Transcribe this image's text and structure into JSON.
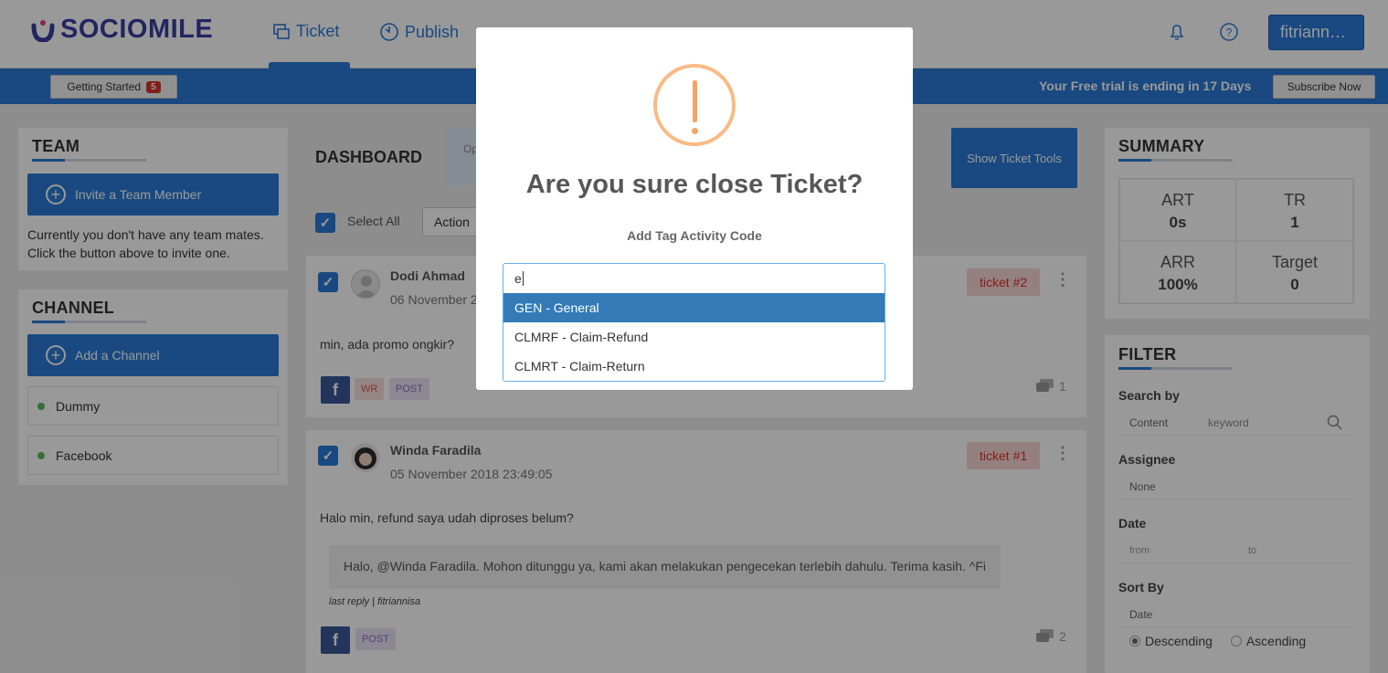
{
  "app": {
    "brand": "SOCIOMILE"
  },
  "nav": {
    "items": [
      {
        "label": "Ticket"
      },
      {
        "label": "Publish"
      }
    ],
    "user_label": "fitriann…"
  },
  "banner": {
    "getting_started_label": "Getting Started",
    "getting_started_count": "5",
    "trial_text": "Your Free trial is ending in 17 Days",
    "subscribe_label": "Subscribe Now"
  },
  "team": {
    "title": "TEAM",
    "invite_label": "Invite a Team Member",
    "empty_text": "Currently you don't have any team mates. Click the button above to invite one."
  },
  "channel": {
    "title": "CHANNEL",
    "add_label": "Add a Channel",
    "items": [
      {
        "label": "Dummy"
      },
      {
        "label": "Facebook"
      }
    ]
  },
  "dashboard": {
    "title": "DASHBOARD",
    "tab_label": "Op",
    "show_tools_label": "Show Ticket Tools",
    "select_all_label": "Select All",
    "action_label": "Action"
  },
  "tickets": [
    {
      "name": "Dodi Ahmad",
      "date": "06 November 2",
      "body": "min, ada promo ongkir?",
      "badge": "ticket #2",
      "tags": [
        "WR",
        "POST"
      ],
      "comments": "1"
    },
    {
      "name": "Winda Faradila",
      "date": "05 November 2018 23:49:05",
      "body": "Halo min, refund saya udah diproses belum?",
      "badge": "ticket #1",
      "tags": [
        "POST"
      ],
      "comments": "2",
      "reply": "Halo, @Winda Faradila. Mohon ditunggu ya, kami akan melakukan pengecekan terlebih dahulu. Terima kasih. ^Fi",
      "reply_meta": "last reply | fitriannisa"
    }
  ],
  "summary": {
    "title": "SUMMARY",
    "cells": [
      {
        "label": "ART",
        "value": "0s"
      },
      {
        "label": "TR",
        "value": "1"
      },
      {
        "label": "ARR",
        "value": "100%"
      },
      {
        "label": "Target",
        "value": "0"
      }
    ]
  },
  "filter": {
    "title": "FILTER",
    "search_by_label": "Search by",
    "search_field": "Content",
    "search_placeholder": "keyword",
    "assignee_label": "Assignee",
    "assignee_value": "None",
    "date_label": "Date",
    "date_from_placeholder": "from",
    "date_to_placeholder": "to",
    "sort_label": "Sort By",
    "sort_value": "Date",
    "sort_desc": "Descending",
    "sort_asc": "Ascending"
  },
  "modal": {
    "title": "Are you sure close Ticket?",
    "subtitle": "Add Tag Activity Code",
    "input_value": "e",
    "options": [
      {
        "label": "GEN - General"
      },
      {
        "label": "CLMRF - Claim-Refund"
      },
      {
        "label": "CLMRT - Claim-Return"
      }
    ]
  }
}
